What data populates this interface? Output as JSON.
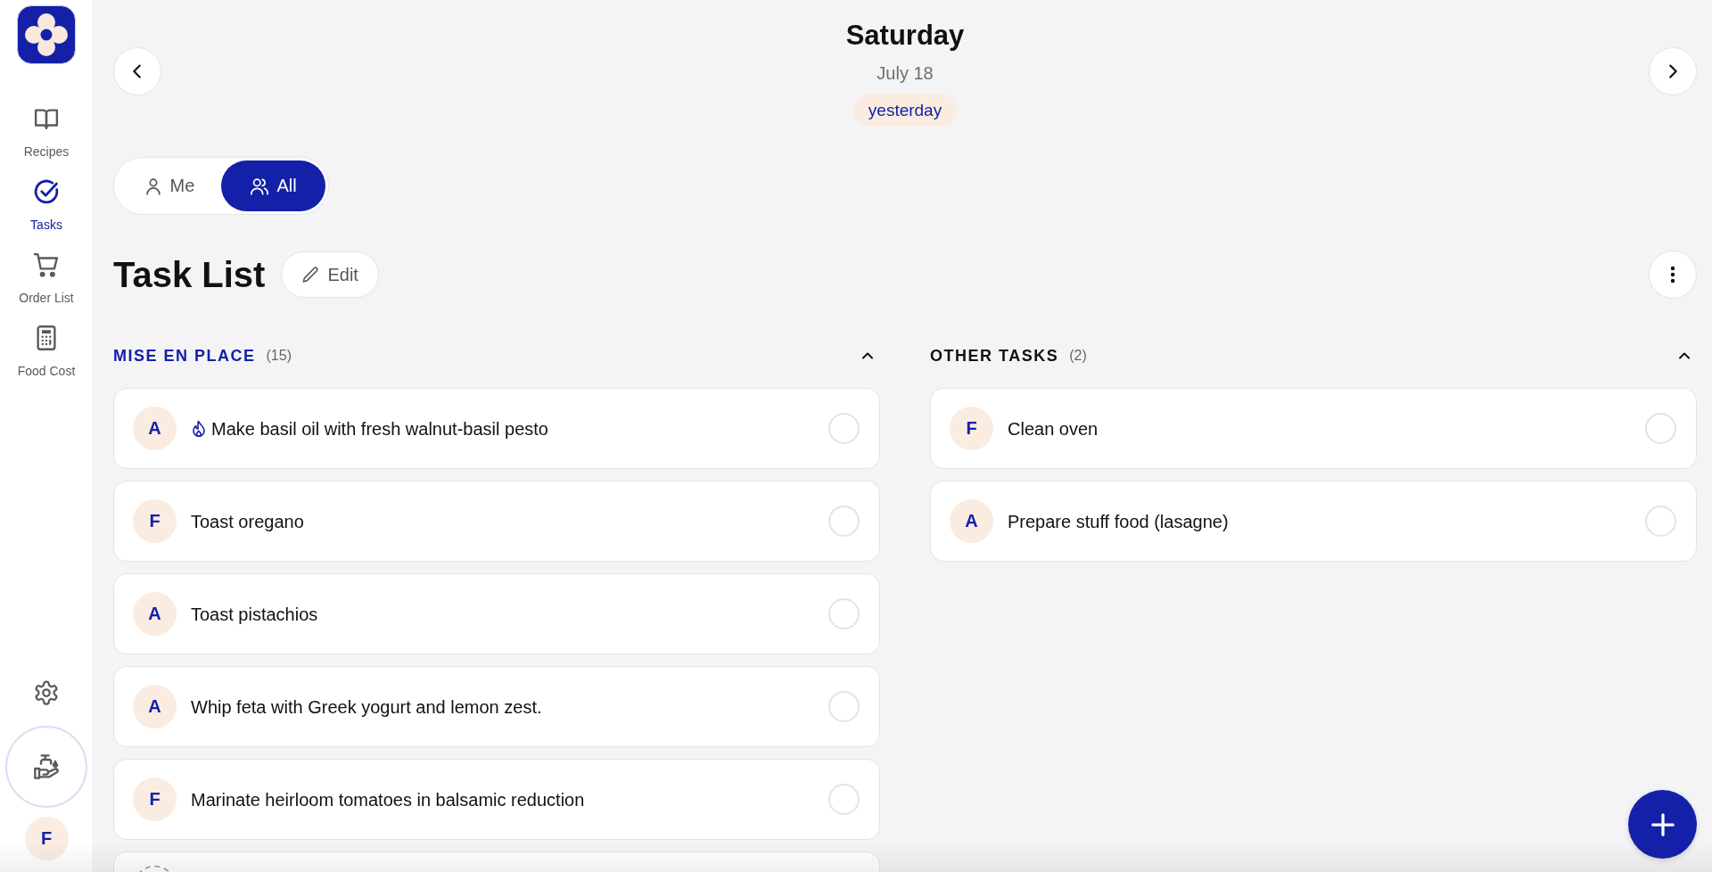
{
  "sidebar": {
    "nav": [
      {
        "label": "Recipes",
        "selected": false
      },
      {
        "label": "Tasks",
        "selected": true
      },
      {
        "label": "Order List",
        "selected": false
      },
      {
        "label": "Food Cost",
        "selected": false
      }
    ],
    "user_initial": "F"
  },
  "header": {
    "day": "Saturday",
    "date": "July 18",
    "relative": "yesterday"
  },
  "scope_tabs": [
    {
      "label": "Me",
      "selected": false
    },
    {
      "label": "All",
      "selected": true
    }
  ],
  "title": "Task List",
  "edit_label": "Edit",
  "sections": [
    {
      "title": "MISE EN PLACE",
      "count": "(15)",
      "highlighted": true,
      "expanded": true,
      "tasks": [
        {
          "kind": "task",
          "assignee": "A",
          "title": "Make basil oil with fresh walnut-basil pesto",
          "urgent": true,
          "done": false
        },
        {
          "kind": "task",
          "assignee": "F",
          "title": "Toast oregano",
          "urgent": false,
          "done": false
        },
        {
          "kind": "task",
          "assignee": "A",
          "title": "Toast pistachios",
          "urgent": false,
          "done": false
        },
        {
          "kind": "task",
          "assignee": "A",
          "title": "Whip feta with Greek yogurt and lemon zest.",
          "urgent": false,
          "done": false
        },
        {
          "kind": "task",
          "assignee": "F",
          "title": "Marinate heirloom tomatoes in balsamic reduction",
          "urgent": false,
          "done": false
        },
        {
          "kind": "cut_off"
        }
      ]
    },
    {
      "title": "OTHER TASKS",
      "count": "(2)",
      "highlighted": false,
      "expanded": true,
      "tasks": [
        {
          "kind": "task",
          "assignee": "F",
          "title": "Clean oven",
          "urgent": false,
          "done": false
        },
        {
          "kind": "task",
          "assignee": "A",
          "title": "Prepare stuff food (lasagne)",
          "urgent": false,
          "done": false
        }
      ]
    }
  ]
}
